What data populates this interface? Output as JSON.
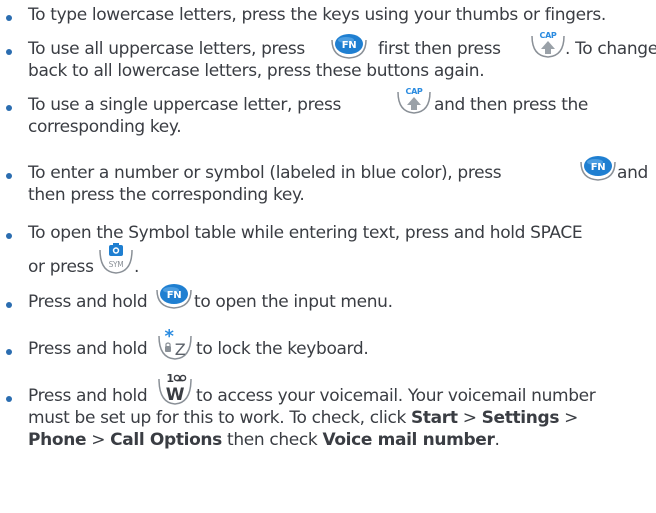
{
  "items": [
    {
      "lines": [
        "To type lowercase letters, press the keys using your thumbs or fingers."
      ]
    },
    {
      "parts": {
        "p1": "To use all uppercase letters, press",
        "p2": "first then press",
        "p3": ". To change",
        "line2": "back to all lowercase letters, press these buttons again."
      },
      "keys": [
        "fn-key-icon",
        "cap-key-icon"
      ]
    },
    {
      "parts": {
        "p1": "To use a single uppercase letter, press",
        "p2": "and then press the",
        "line2": "corresponding key."
      },
      "keys": [
        "cap-key-icon"
      ]
    },
    {
      "parts": {
        "p1": "To enter a number or symbol (labeled in blue color), press",
        "p2": "and",
        "line2": "then press the corresponding key."
      },
      "keys": [
        "fn-key-icon"
      ]
    },
    {
      "parts": {
        "p1": "To open the Symbol table while entering text, press and hold SPACE",
        "line2a": "or press",
        "line2b": "."
      },
      "keys": [
        "sym-key-icon"
      ]
    },
    {
      "parts": {
        "p1": "Press and hold",
        "p2": "to open the input menu."
      },
      "keys": [
        "fn-key-icon"
      ]
    },
    {
      "parts": {
        "p1": "Press and hold",
        "p2": "to lock the keyboard."
      },
      "keys": [
        "star-z-lock-key-icon"
      ]
    },
    {
      "parts": {
        "p1": "Press and hold",
        "p2": "to access your voicemail. Your voicemail number",
        "line2": "must be set up for this to work. To check, click",
        "start": "Start",
        "gt1": ">",
        "settings": "Settings",
        "gt2": ">",
        "phone": "Phone",
        "gt3": ">",
        "calloptions": "Call Options",
        "thencheck": "then check",
        "voicemail": "Voice mail number",
        "period": "."
      },
      "keys": [
        "voicemail-1-w-key-icon"
      ]
    }
  ],
  "key_labels": {
    "fn": "FN",
    "cap": "CAP",
    "sym": "SYM",
    "one": "1",
    "w": "W",
    "z": "Z",
    "star": "*"
  },
  "colors": {
    "text": "#3a3d43",
    "bullet": "#2b6db0",
    "fn_key": "#1f7fd1",
    "key_outline": "#8a9097",
    "key_label_blue": "#2a8be0"
  }
}
